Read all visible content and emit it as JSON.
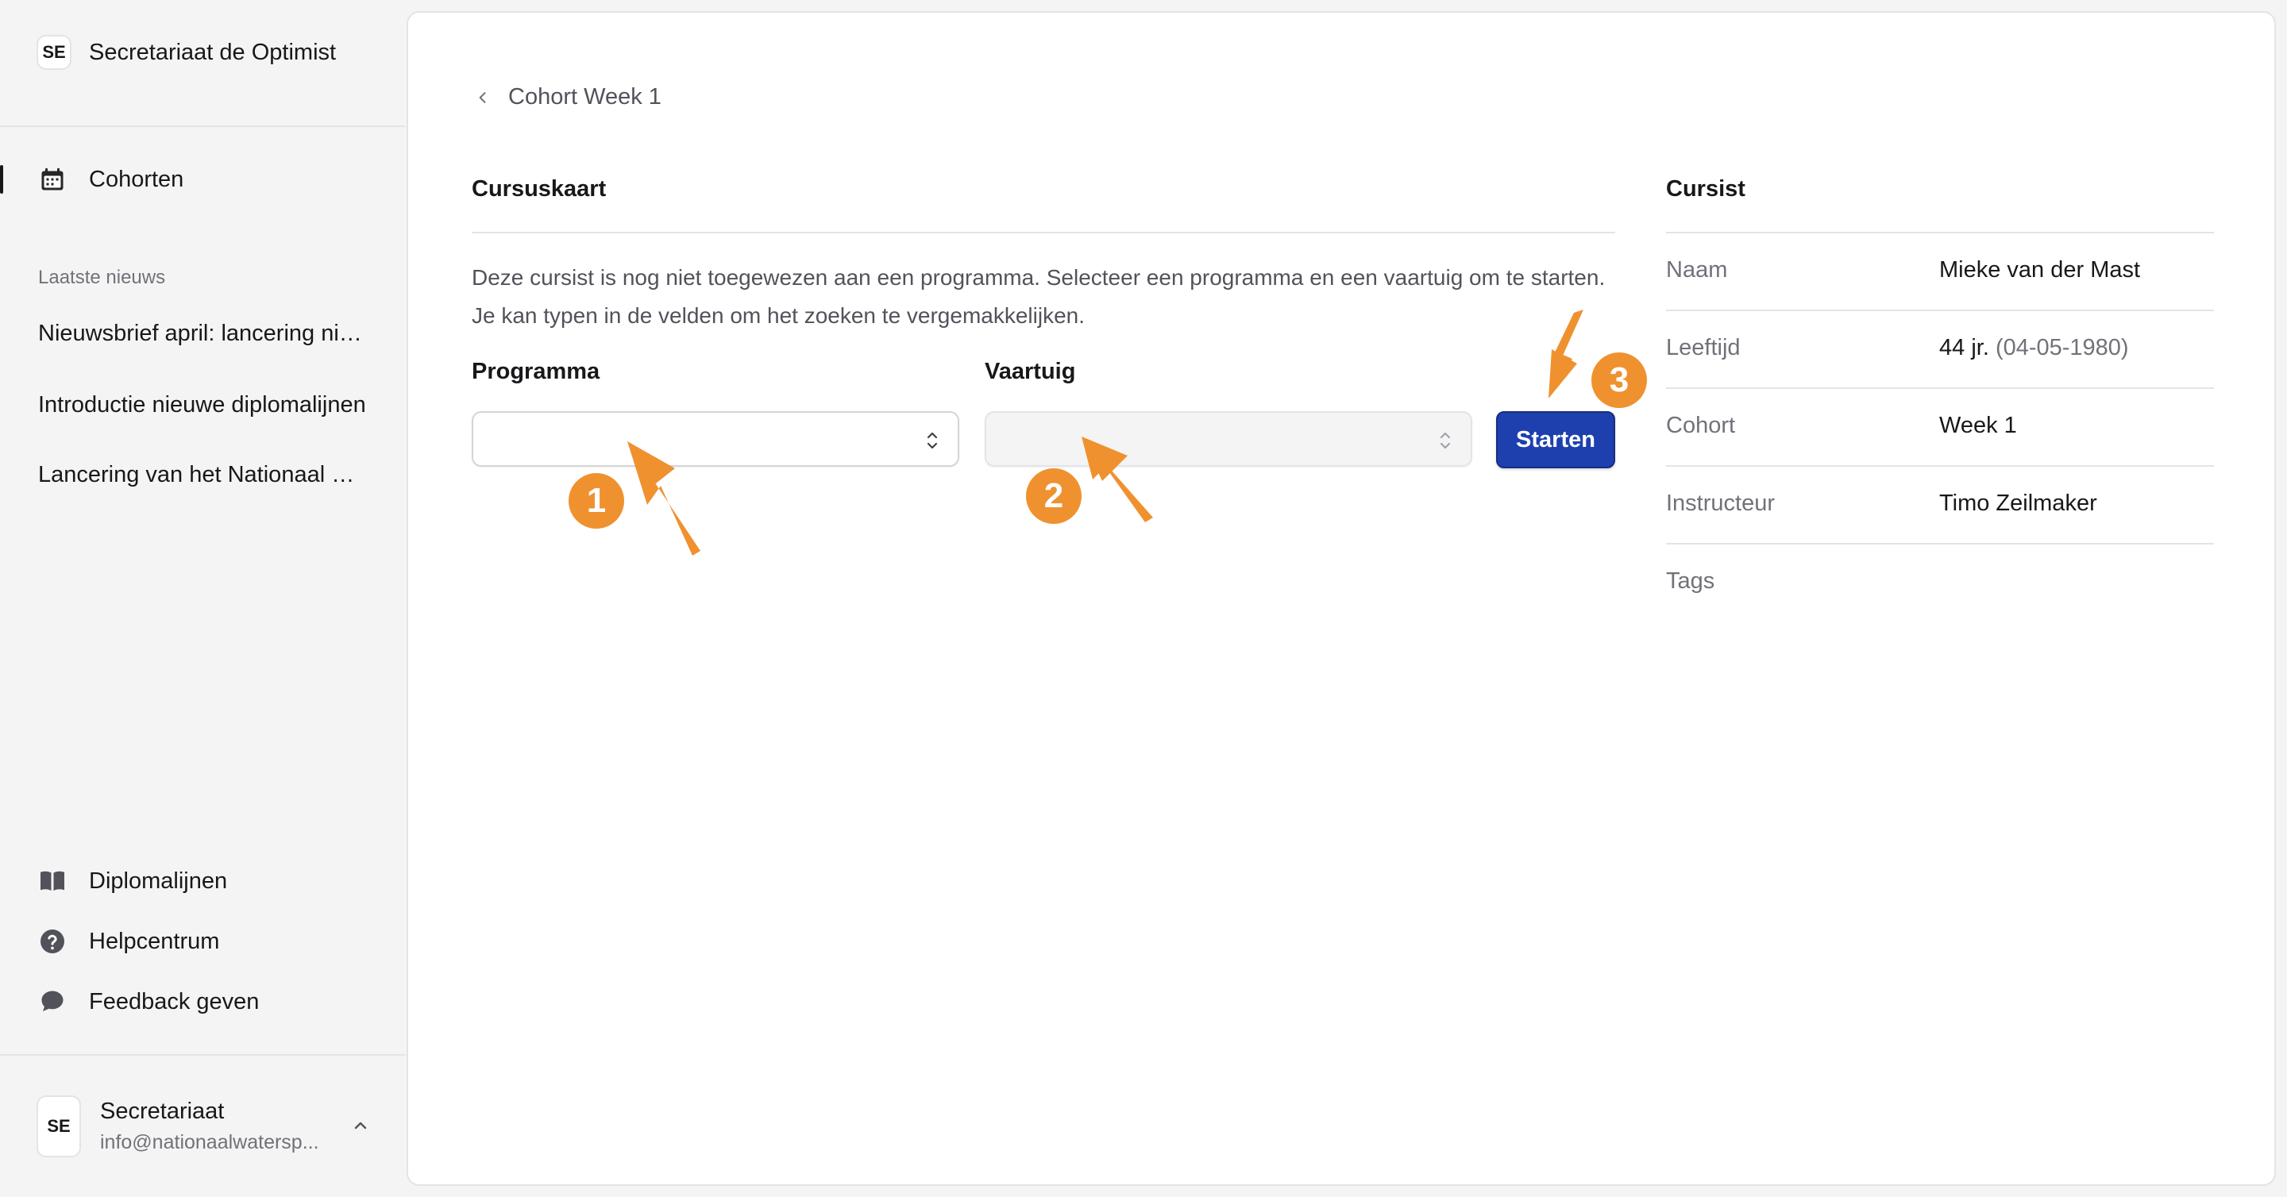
{
  "sidebar": {
    "team_initials": "SE",
    "team_name": "Secretariaat de Optimist",
    "nav_main": "Cohorten",
    "news_label": "Laatste nieuws",
    "news_items": [
      "Nieuwsbrief april: lancering nieuwe diplomalijnen",
      "Introductie nieuwe diplomalijnen",
      "Lancering van het Nationaal Watersport Diploma"
    ],
    "footer_nav": [
      "Diplomalijnen",
      "Helpcentrum",
      "Feedback geven"
    ],
    "user": {
      "initials": "SE",
      "name": "Secretariaat",
      "email": "info@nationaalwatersp..."
    }
  },
  "breadcrumb": "Cohort Week 1",
  "cursuskaart": {
    "title": "Cursuskaart",
    "description": "Deze cursist is nog niet toegewezen aan een programma. Selecteer een programma en een vaartuig om te starten. Je kan typen in de velden om het zoeken te vergemakkelijken.",
    "programma_label": "Programma",
    "programma_value": "",
    "vaartuig_label": "Vaartuig",
    "vaartuig_value": "",
    "start_button": "Starten"
  },
  "cursist": {
    "title": "Cursist",
    "rows": [
      {
        "key": "Naam",
        "value": "Mieke van der Mast",
        "extra": ""
      },
      {
        "key": "Leeftijd",
        "value": "44 jr.",
        "extra": "(04-05-1980)"
      },
      {
        "key": "Cohort",
        "value": "Week 1",
        "extra": ""
      },
      {
        "key": "Instructeur",
        "value": "Timo Zeilmaker",
        "extra": ""
      },
      {
        "key": "Tags",
        "value": "",
        "extra": ""
      }
    ]
  },
  "annotations": [
    "1",
    "2",
    "3"
  ],
  "colors": {
    "accent": "#1e40af",
    "annotation": "#f0912f",
    "sidebar_bg": "#f4f4f5"
  }
}
